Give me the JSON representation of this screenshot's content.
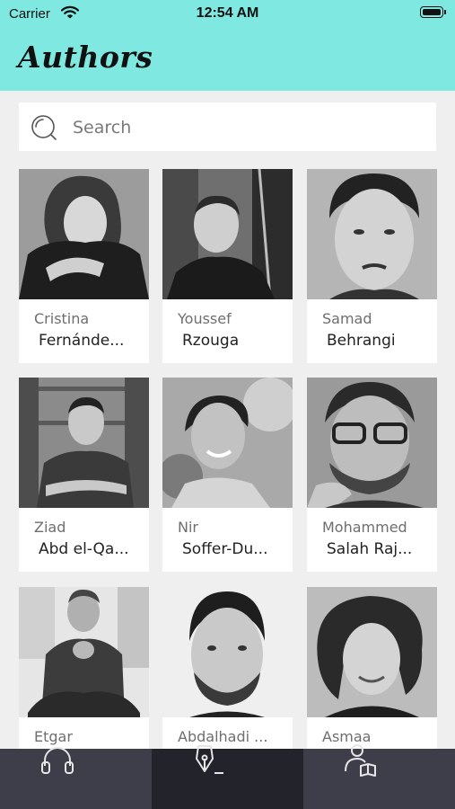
{
  "status_bar": {
    "carrier": "Carrier",
    "time": "12:54 AM"
  },
  "header": {
    "title": "Authors"
  },
  "search": {
    "placeholder": "Search"
  },
  "authors": [
    {
      "first": "Cristina",
      "last": "Fernánde..."
    },
    {
      "first": "Youssef",
      "last": "Rzouga"
    },
    {
      "first": "Samad",
      "last": "Behrangi"
    },
    {
      "first": "Ziad",
      "last": "Abd el-Qa..."
    },
    {
      "first": "Nir",
      "last": "Soffer-Du..."
    },
    {
      "first": "Mohammed",
      "last": "Salah Raj..."
    },
    {
      "first": "Etgar",
      "last": ""
    },
    {
      "first": "Abdalhadi ...",
      "last": ""
    },
    {
      "first": "Asmaa",
      "last": ""
    }
  ],
  "tabs": [
    {
      "icon": "headphones-icon"
    },
    {
      "icon": "pen-nib-icon",
      "active": true
    },
    {
      "icon": "reader-book-icon"
    }
  ],
  "colors": {
    "header": "#7fe8e0",
    "tabbar": "#3d3e4a",
    "tab_active": "#23232c",
    "background": "#efefef"
  }
}
